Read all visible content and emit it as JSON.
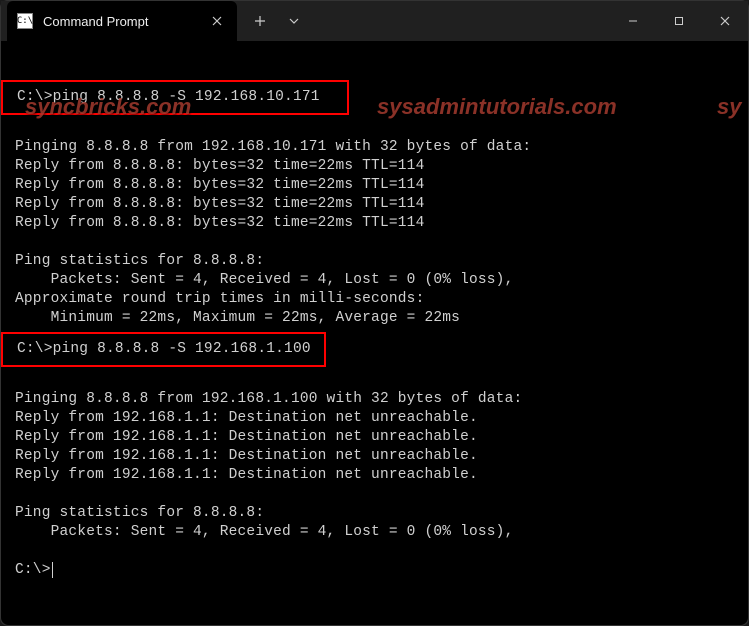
{
  "tab": {
    "title": "Command Prompt",
    "icon_label": "C:\\"
  },
  "watermark": {
    "text1": "syncbricks.com",
    "text2": "sysadmintutorials.com",
    "text3": "sy"
  },
  "block1": {
    "cmd": "C:\\>ping 8.8.8.8 -S 192.168.10.171",
    "header": "Pinging 8.8.8.8 from 192.168.10.171 with 32 bytes of data:",
    "reply1": "Reply from 8.8.8.8: bytes=32 time=22ms TTL=114",
    "reply2": "Reply from 8.8.8.8: bytes=32 time=22ms TTL=114",
    "reply3": "Reply from 8.8.8.8: bytes=32 time=22ms TTL=114",
    "reply4": "Reply from 8.8.8.8: bytes=32 time=22ms TTL=114",
    "stats_hdr": "Ping statistics for 8.8.8.8:",
    "stats_pkts": "    Packets: Sent = 4, Received = 4, Lost = 0 (0% loss),",
    "rtt_hdr": "Approximate round trip times in milli-seconds:",
    "rtt_vals": "    Minimum = 22ms, Maximum = 22ms, Average = 22ms"
  },
  "block2": {
    "cmd": "C:\\>ping 8.8.8.8 -S 192.168.1.100",
    "header": "Pinging 8.8.8.8 from 192.168.1.100 with 32 bytes of data:",
    "reply1": "Reply from 192.168.1.1: Destination net unreachable.",
    "reply2": "Reply from 192.168.1.1: Destination net unreachable.",
    "reply3": "Reply from 192.168.1.1: Destination net unreachable.",
    "reply4": "Reply from 192.168.1.1: Destination net unreachable.",
    "stats_hdr": "Ping statistics for 8.8.8.8:",
    "stats_pkts": "    Packets: Sent = 4, Received = 4, Lost = 0 (0% loss),"
  },
  "prompt_final": "C:\\>"
}
